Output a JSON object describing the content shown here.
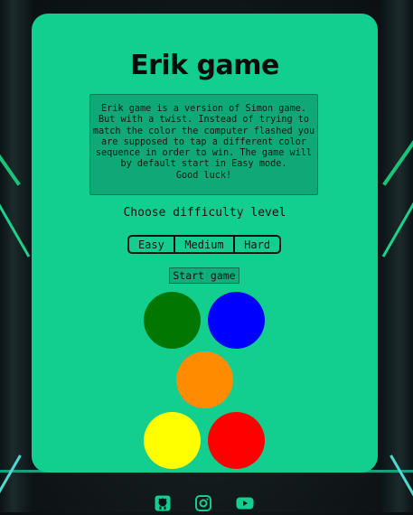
{
  "game": {
    "title": "Erik game",
    "description": "Erik game is a version of Simon game. But with a twist. Instead of trying to match the color the computer flashed you are supposed to tap a different color sequence in order to win. The game will by default start in Easy mode.",
    "closing": "Good luck!",
    "choose_label": "Choose difficulty level",
    "difficulty": [
      {
        "id": "easy",
        "label": "Easy"
      },
      {
        "id": "medium",
        "label": "Medium"
      },
      {
        "id": "hard",
        "label": "Hard"
      }
    ],
    "start_label": "Start game",
    "pads": [
      {
        "name": "green",
        "color": "#007700"
      },
      {
        "name": "blue",
        "color": "#0000ff"
      },
      {
        "name": "orange",
        "color": "#ff8c00"
      },
      {
        "name": "yellow",
        "color": "#ffff00"
      },
      {
        "name": "red",
        "color": "#ff0000"
      }
    ]
  },
  "colors": {
    "card": "#12cf8f",
    "accent_dark": "#0b6e4c"
  },
  "footer": {
    "icons": [
      "github-icon",
      "instagram-icon",
      "youtube-icon"
    ]
  }
}
